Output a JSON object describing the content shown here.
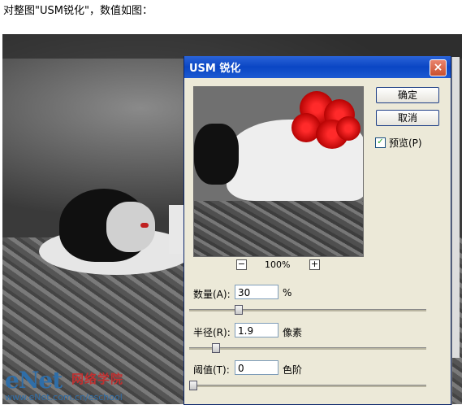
{
  "caption": "对整图\"USM锐化\"，数值如图：",
  "dialog": {
    "title": "USM 锐化",
    "ok_label": "确定",
    "cancel_label": "取消",
    "preview_label": "预览(P)",
    "preview_checked": "✓",
    "zoom": "100%",
    "zoom_minus": "−",
    "zoom_plus": "+",
    "amount": {
      "label": "数量(A):",
      "value": "30",
      "unit": "%",
      "slider_fraction": 0.2
    },
    "radius": {
      "label": "半径(R):",
      "value": "1.9",
      "unit": "像素",
      "slider_fraction": 0.1
    },
    "threshold": {
      "label": "阈值(T):",
      "value": "0",
      "unit": "色阶",
      "slider_fraction": 0.0
    }
  },
  "watermark": {
    "brand": "eNet",
    "chinese": "网络学院",
    "url": "www.eNet.com.cn/eschool"
  },
  "colors": {
    "titlebar": "#0a46c4",
    "dialog_bg": "#ece9d8",
    "rose": "#e01010"
  }
}
